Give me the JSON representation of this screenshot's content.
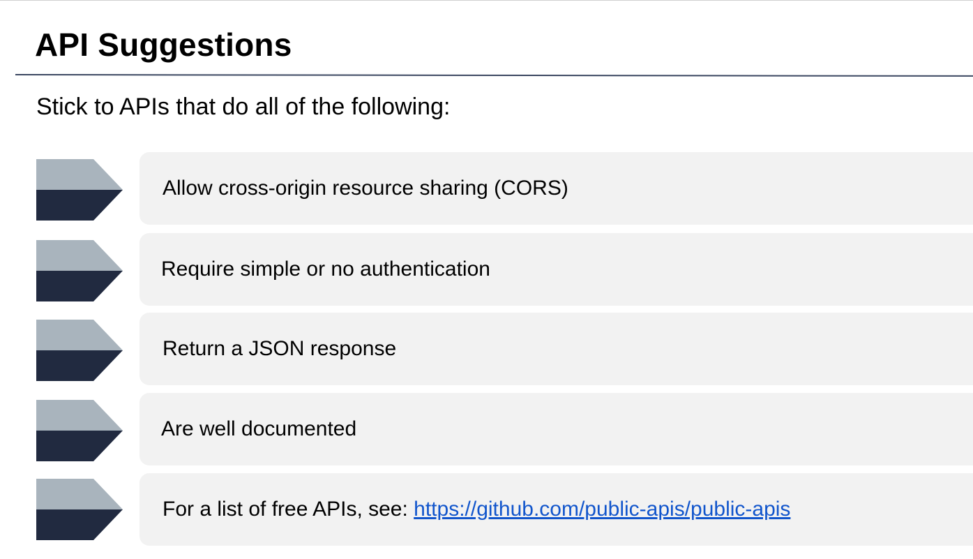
{
  "slide": {
    "title": "API Suggestions",
    "subtitle": "Stick to APIs that do all of the following:",
    "items": [
      {
        "text": "Allow cross-origin resource sharing (CORS)"
      },
      {
        "text": "Require simple or no authentication"
      },
      {
        "text": "Return a JSON response"
      },
      {
        "text": "Are well documented"
      },
      {
        "text": "For a list of free APIs, see: ",
        "link": "https://github.com/public-apis/public-apis"
      }
    ],
    "icon": "chevron-bullet-icon"
  },
  "colors": {
    "rule": "#3a4660",
    "chevron_top": "#a9b4bd",
    "chevron_bottom": "#212a40",
    "card_background": "#f2f2f2",
    "link": "#1155cc"
  }
}
